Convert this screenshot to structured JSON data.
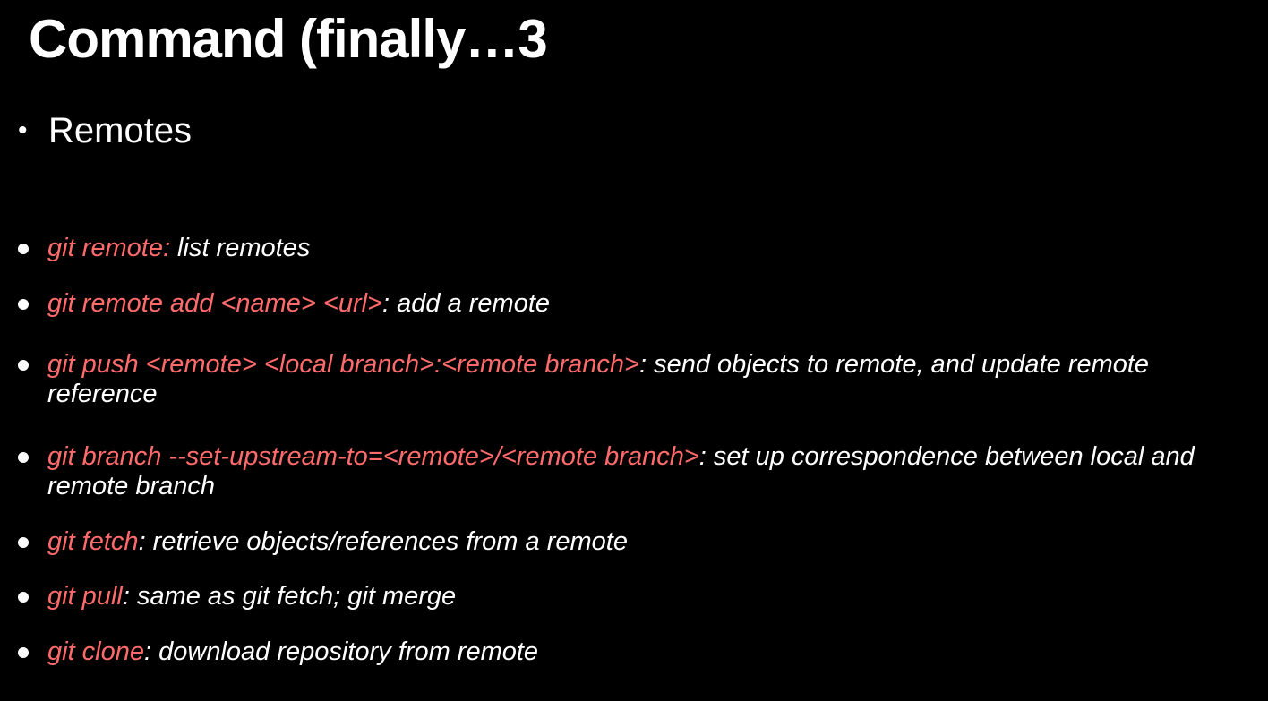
{
  "slide": {
    "title": "Command (finally…3",
    "section_bullet": "•",
    "section_label": "Remotes",
    "items": [
      {
        "command": "git remote:",
        "description": " list remotes"
      },
      {
        "command": "git remote add <name> <url>",
        "description": ": add a remote"
      },
      {
        "command": "git push <remote> <local branch>:<remote branch>",
        "description": ": send objects to remote, and update remote reference"
      },
      {
        "command": "git branch --set-upstream-to=<remote>/<remote branch>",
        "description": ": set up correspondence between local and remote branch"
      },
      {
        "command": "git fetch",
        "description": ": retrieve objects/references from a remote"
      },
      {
        "command": "git pull",
        "description": ": same as git fetch; git merge"
      },
      {
        "command": "git clone",
        "description": ": download repository from remote"
      }
    ]
  },
  "colors": {
    "background": "#000000",
    "text": "#ffffff",
    "command": "#ff6b6b"
  }
}
